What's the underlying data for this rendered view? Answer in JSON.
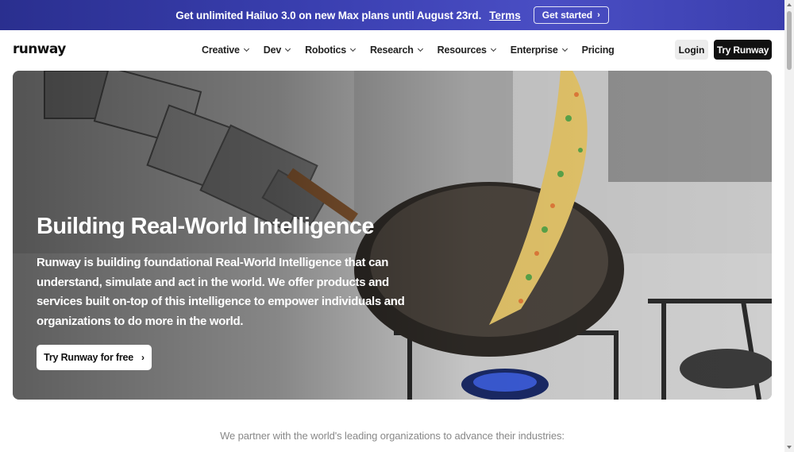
{
  "banner": {
    "text": "Get unlimited Hailuo 3.0 on new Max plans until August 23rd.",
    "terms_label": "Terms",
    "cta_label": "Get started",
    "cta_icon": "chevron-right-icon",
    "background": "#3a3fb0"
  },
  "nav": {
    "logo": "runway",
    "menu": [
      {
        "label": "Creative",
        "has_dropdown": true
      },
      {
        "label": "Dev",
        "has_dropdown": true
      },
      {
        "label": "Robotics",
        "has_dropdown": true
      },
      {
        "label": "Research",
        "has_dropdown": true
      },
      {
        "label": "Resources",
        "has_dropdown": true
      },
      {
        "label": "Enterprise",
        "has_dropdown": true
      },
      {
        "label": "Pricing",
        "has_dropdown": false
      }
    ],
    "login_label": "Login",
    "try_label": "Try Runway"
  },
  "hero": {
    "title": "Building Real-World Intelligence",
    "description": "Runway is building foundational Real-World Intelligence that can understand, simulate and act in the world. We offer products and services built on-top of this intelligence to empower individuals and organizations to do more in the world.",
    "cta_label": "Try Runway for free",
    "cta_icon": "chevron-right-icon"
  },
  "partners": {
    "text": "We partner with the world's leading organizations to advance their industries:"
  },
  "colors": {
    "accent_dark": "#111111",
    "banner": "#3a3fb0"
  }
}
